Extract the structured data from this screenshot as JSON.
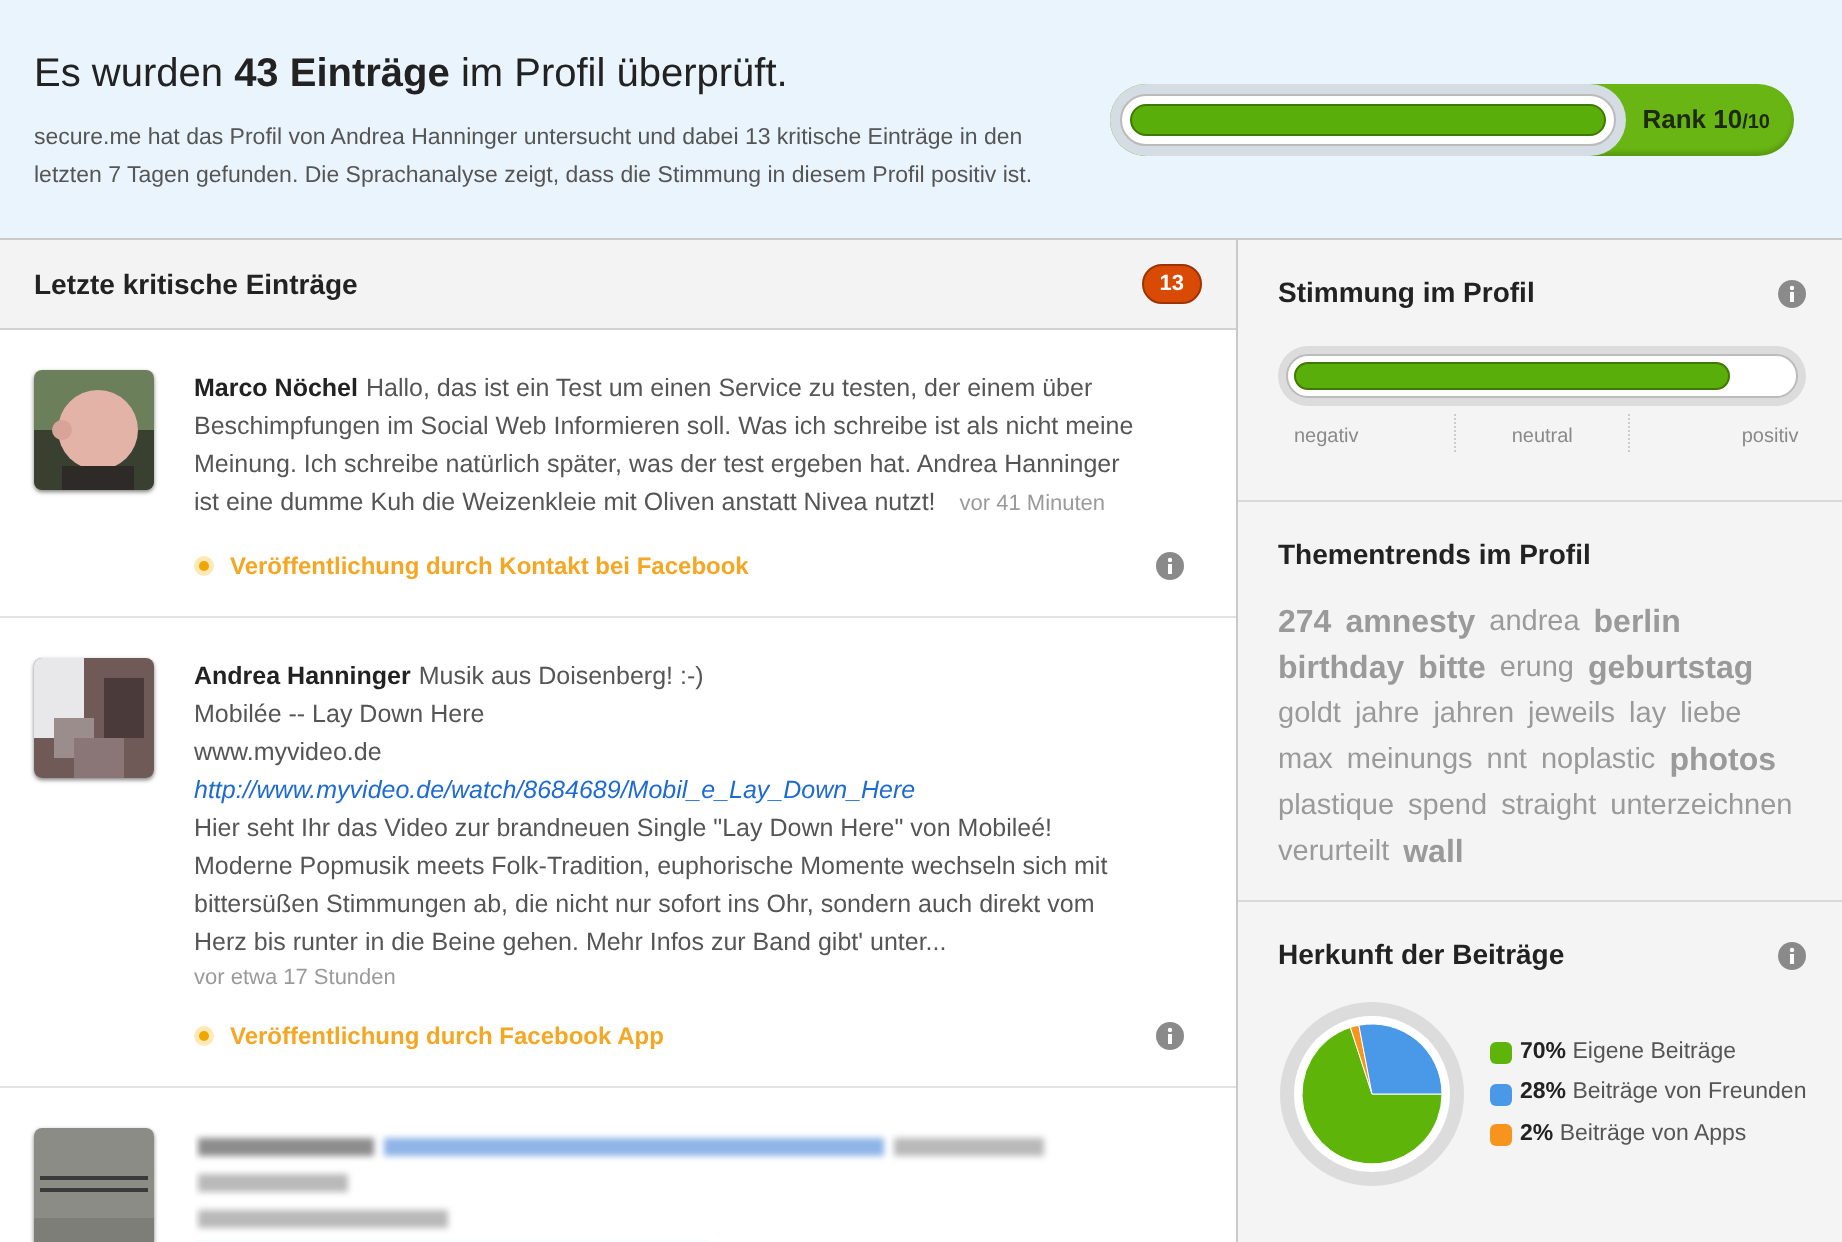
{
  "summary": {
    "title": "Es wurden **43 Einträge** im Profil überprüft.",
    "text": "secure.me hat das Profil von Andrea Hanninger untersucht und dabei 13 kritische Einträge in den letzten 7 Tagen gefunden. Die Sprachanalyse zeigt, dass die Stimmung in diesem Profil positiv ist.",
    "rank": {
      "level": 1.0,
      "label": "Rank 10",
      "suffix": "/10"
    }
  },
  "entries_panel": {
    "title": "Letzte kritische Einträge",
    "count": "13",
    "entries": [
      {
        "kind": "post",
        "author": "Marco Nöchel",
        "body": [
          {
            "kind": "text",
            "text": "Hallo, das ist ein Test um einen Service zu testen, der einem über Beschimpfungen im Social Web Informieren soll. Was ich schreibe ist als nicht meine Meinung. Ich schreibe natürlich später, was der test ergeben hat. Andrea Hanninger ist eine dumme Kuh die Weizenkleie mit Oliven anstatt Nivea nutzt!"
          }
        ],
        "time": "vor 41 Minuten",
        "time_inline": true,
        "source": "Veröffentlichung durch Kontakt bei Facebook"
      },
      {
        "kind": "post",
        "author": "Andrea Hanninger",
        "body": [
          {
            "kind": "text",
            "text": "Musik aus Doisenberg! :-)"
          },
          {
            "kind": "text",
            "text": "Mobilée -- Lay Down Here"
          },
          {
            "kind": "text",
            "text": "www.myvideo.de"
          },
          {
            "kind": "link",
            "text": "http://www.myvideo.de/watch/8684689/Mobil_e_Lay_Down_Here"
          },
          {
            "kind": "text",
            "text": "Hier seht Ihr das Video zur brandneuen Single \"Lay Down Here\" von Mobileé! Moderne Popmusik meets Folk-Tradition, euphorische Momente wechseln sich mit bittersüßen Stimmungen ab, die nicht nur sofort ins Ohr, sondern auch direkt vom Herz bis runter in die Beine gehen. Mehr Infos zur Band gibt' unter..."
          }
        ],
        "time": "vor etwa 17 Stunden",
        "time_inline": false,
        "source": "Veröffentlichung durch Facebook App"
      },
      {
        "kind": "blurred"
      }
    ]
  },
  "mood": {
    "title": "Stimmung im Profil",
    "level": 0.88,
    "labels": [
      "negativ",
      "neutral",
      "positiv"
    ]
  },
  "trends": {
    "title": "Thementrends im Profil",
    "tags": [
      {
        "text": "274",
        "bold": true
      },
      {
        "text": "amnesty",
        "bold": true
      },
      {
        "text": "andrea",
        "bold": false
      },
      {
        "text": "berlin",
        "bold": true
      },
      {
        "text": "birthday",
        "bold": true
      },
      {
        "text": "bitte",
        "bold": true
      },
      {
        "text": "erung",
        "bold": false
      },
      {
        "text": "geburtstag",
        "bold": true
      },
      {
        "text": "goldt",
        "bold": false
      },
      {
        "text": "jahre",
        "bold": false
      },
      {
        "text": "jahren",
        "bold": false
      },
      {
        "text": "jeweils",
        "bold": false
      },
      {
        "text": "lay",
        "bold": false
      },
      {
        "text": "liebe",
        "bold": false
      },
      {
        "text": "max",
        "bold": false
      },
      {
        "text": "meinungs",
        "bold": false
      },
      {
        "text": "nnt",
        "bold": false
      },
      {
        "text": "noplastic",
        "bold": false
      },
      {
        "text": "photos",
        "bold": true
      },
      {
        "text": "plastique",
        "bold": false
      },
      {
        "text": "spend",
        "bold": false
      },
      {
        "text": "straight",
        "bold": false
      },
      {
        "text": "unterzeichnen",
        "bold": false
      },
      {
        "text": "verurteilt",
        "bold": false
      },
      {
        "text": "wall",
        "bold": true
      }
    ]
  },
  "origin": {
    "title": "Herkunft der Beiträge",
    "legend": [
      {
        "percent": "70%",
        "color": "#5fb40a"
      },
      {
        "percent": "28%",
        "color": "#4a98e8"
      },
      {
        "percent": "2%",
        "color": "#f7941d"
      }
    ],
    "chart_data": {
      "type": "pie",
      "categories": [
        "Eigene Beiträge",
        "Beiträge von Freunden",
        "Beiträge von Apps"
      ],
      "values": [
        70,
        28,
        2
      ]
    }
  }
}
